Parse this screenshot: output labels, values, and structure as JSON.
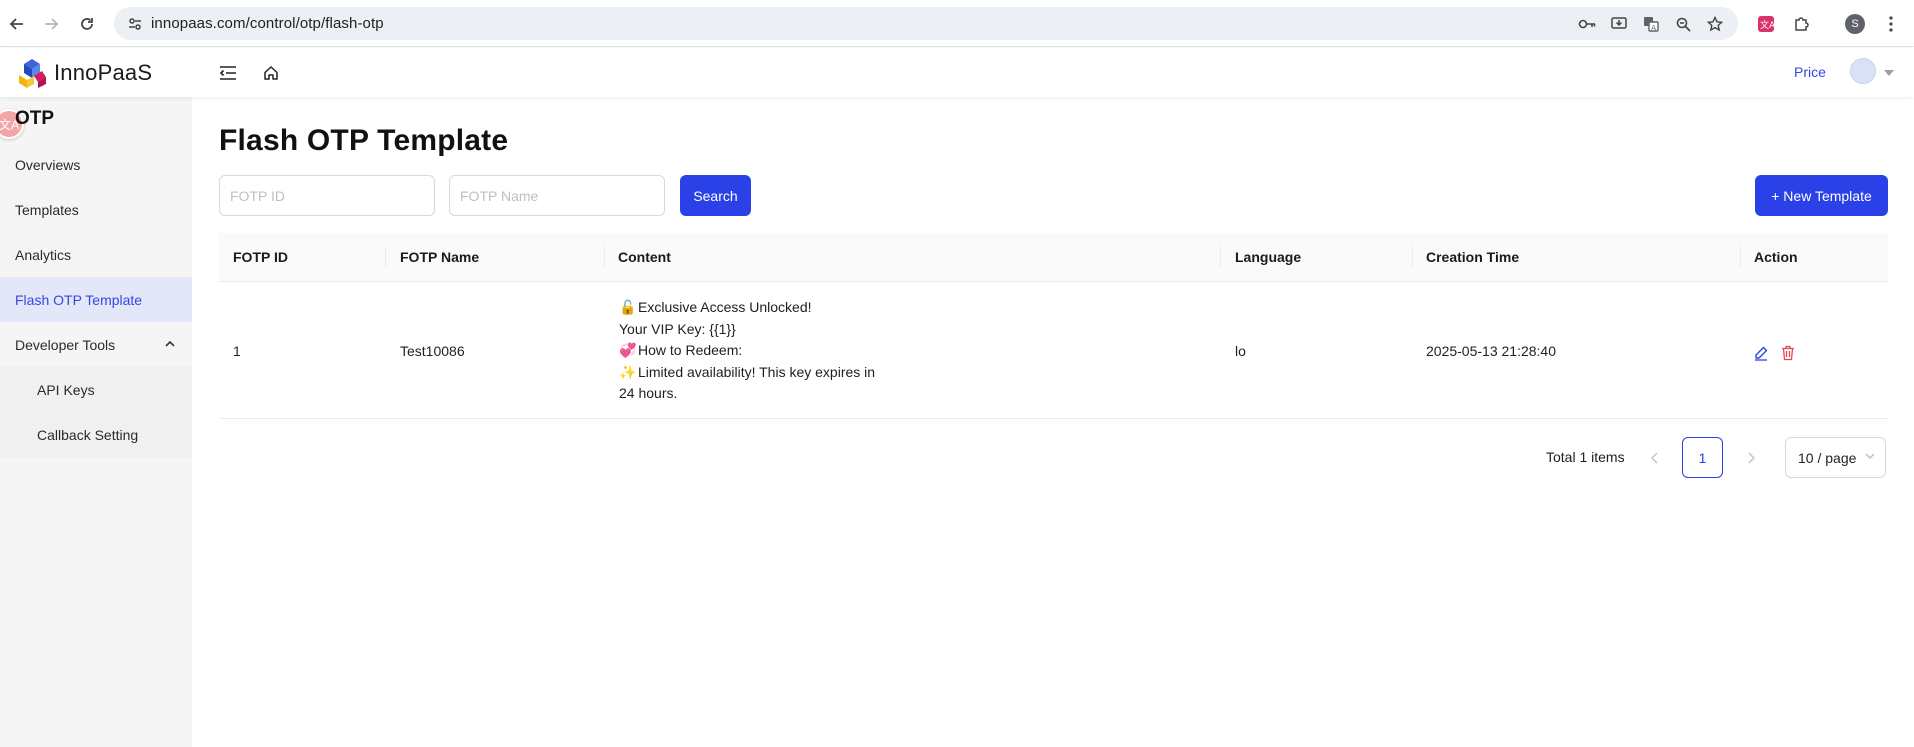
{
  "browser": {
    "url": "innopaas.com/control/otp/flash-otp",
    "profile_initial": "S",
    "icons": [
      "back-icon",
      "forward-icon",
      "reload-icon",
      "site-info-icon",
      "password-key-icon",
      "install-app-icon",
      "translate-icon",
      "zoom-icon",
      "bookmark-star-icon",
      "extension-translate-icon",
      "extensions-puzzle-icon",
      "menu-dots-icon"
    ]
  },
  "header": {
    "logo_text": "InnoPaaS",
    "price_label": "Price"
  },
  "sidebar": {
    "section_title": "OTP",
    "translate_badge": "文A",
    "items": [
      {
        "label": "Overviews"
      },
      {
        "label": "Templates"
      },
      {
        "label": "Analytics"
      },
      {
        "label": "Flash OTP Template",
        "active": true
      },
      {
        "label": "Developer Tools",
        "expanded": true
      },
      {
        "label": "API Keys"
      },
      {
        "label": "Callback Setting"
      }
    ]
  },
  "main": {
    "title": "Flash OTP Template",
    "filters": {
      "id_placeholder": "FOTP ID",
      "name_placeholder": "FOTP Name",
      "search_label": "Search"
    },
    "new_template_label": "+ New Template",
    "table": {
      "columns": [
        "FOTP ID",
        "FOTP Name",
        "Content",
        "Language",
        "Creation Time",
        "Action"
      ],
      "rows": [
        {
          "id": "1",
          "name": "Test10086",
          "content": {
            "line1_emoji": "🔓",
            "line1": "Exclusive Access Unlocked!",
            "line2": "Your VIP Key: {{1}}",
            "line3_emoji": "💞",
            "line3": "How to Redeem:",
            "line4_emoji": "✨",
            "line4": "Limited availability! This key expires in",
            "line5": "24 hours."
          },
          "language": "lo",
          "creation_time": "2025-05-13 21:28:40"
        }
      ]
    },
    "pagination": {
      "total_text": "Total 1 items",
      "current_page": "1",
      "page_size": "10 / page"
    }
  },
  "colors": {
    "accent": "#2a41e8",
    "sidebar_active_bg": "#e3e7f7",
    "delete": "#e5484d"
  }
}
